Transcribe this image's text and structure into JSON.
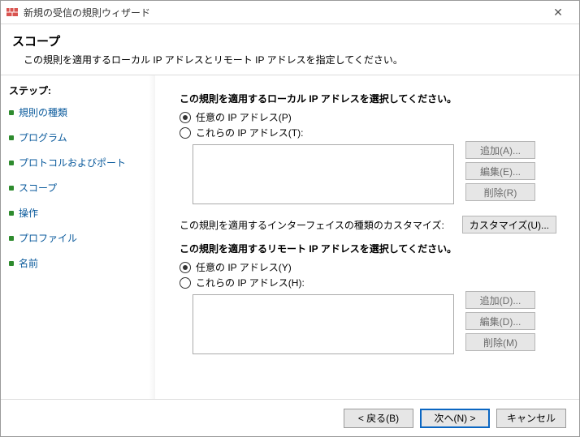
{
  "window": {
    "title": "新規の受信の規則ウィザード",
    "close_icon_glyph": "✕"
  },
  "header": {
    "title": "スコープ",
    "subtitle": "この規則を適用するローカル IP アドレスとリモート IP アドレスを指定してください。"
  },
  "sidebar": {
    "label": "ステップ:",
    "steps": [
      {
        "label": "規則の種類"
      },
      {
        "label": "プログラム"
      },
      {
        "label": "プロトコルおよびポート"
      },
      {
        "label": "スコープ"
      },
      {
        "label": "操作"
      },
      {
        "label": "プロファイル"
      },
      {
        "label": "名前"
      }
    ]
  },
  "content": {
    "local": {
      "title": "この規則を適用するローカル IP アドレスを選択してください。",
      "radio_any": "任意の IP アドレス(P)",
      "radio_these": "これらの IP アドレス(T):",
      "selected": "any",
      "buttons": {
        "add": "追加(A)...",
        "edit": "編集(E)...",
        "remove": "削除(R)"
      }
    },
    "interface": {
      "label": "この規則を適用するインターフェイスの種類のカスタマイズ:",
      "button": "カスタマイズ(U)..."
    },
    "remote": {
      "title": "この規則を適用するリモート IP アドレスを選択してください。",
      "radio_any": "任意の IP アドレス(Y)",
      "radio_these": "これらの IP アドレス(H):",
      "selected": "any",
      "buttons": {
        "add": "追加(D)...",
        "edit": "編集(D)...",
        "remove": "削除(M)"
      }
    }
  },
  "footer": {
    "back": "< 戻る(B)",
    "next": "次へ(N) >",
    "cancel": "キャンセル"
  }
}
